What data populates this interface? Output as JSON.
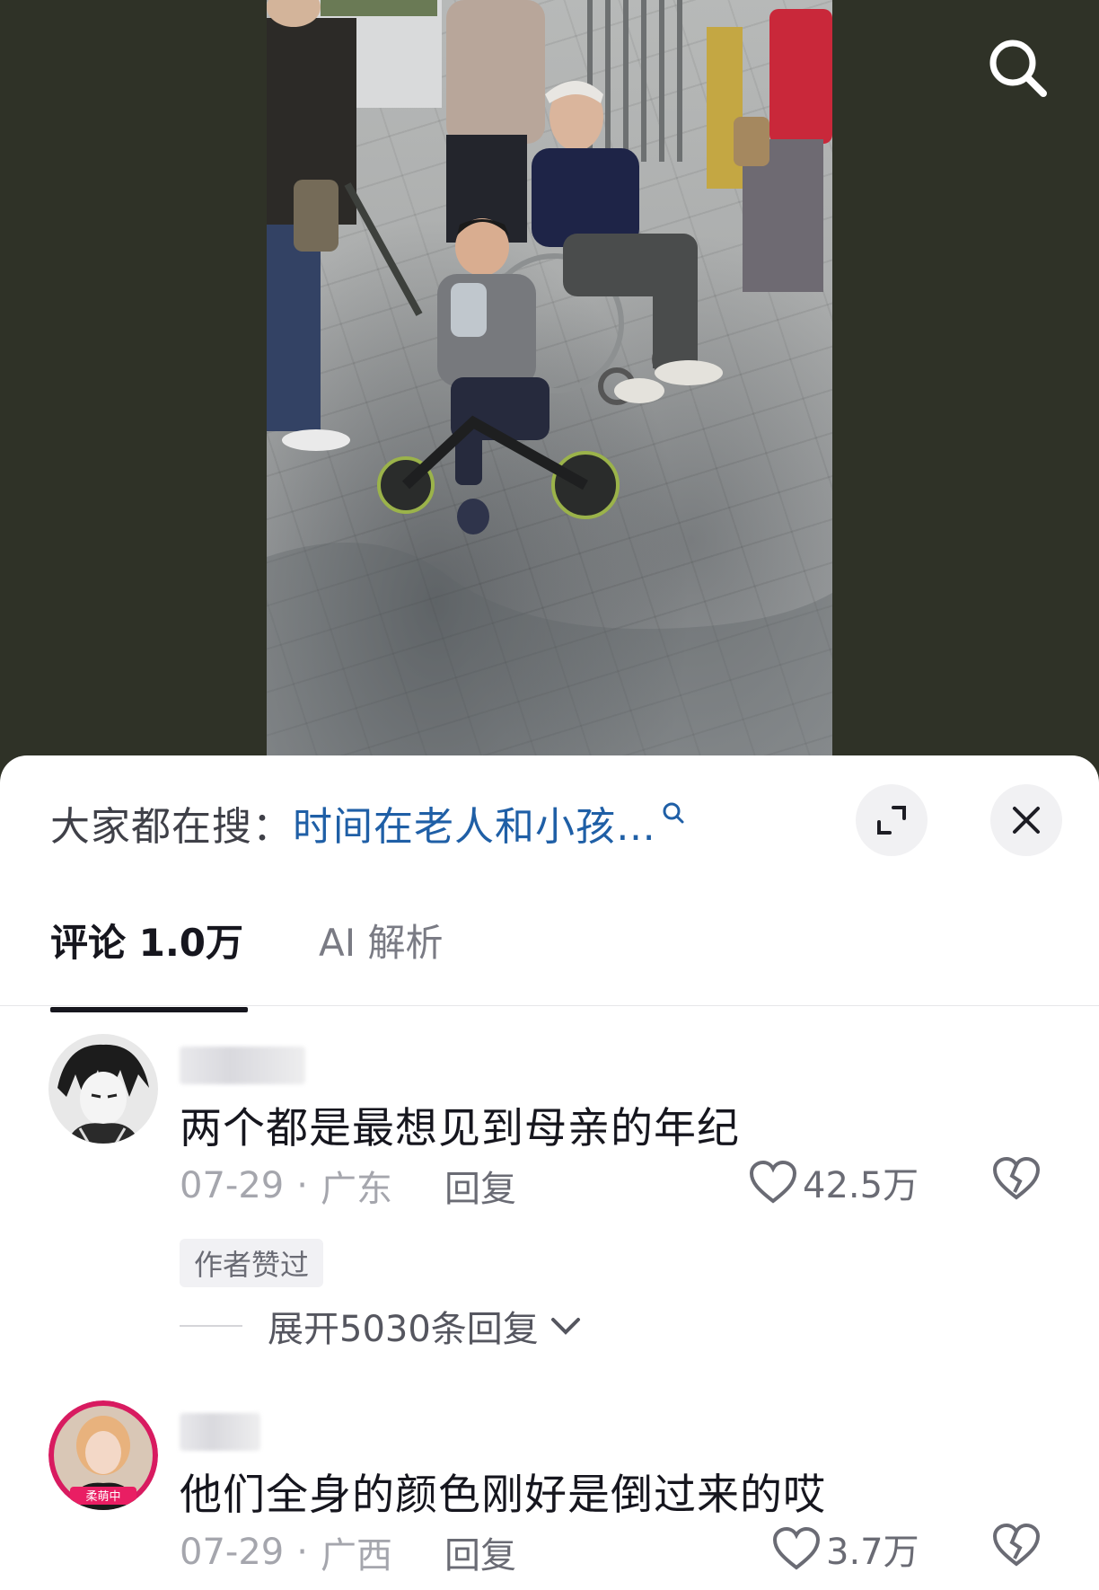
{
  "sheet": {
    "hot_search_label": "大家都在搜：",
    "hot_search_query": "时间在老人和小孩…"
  },
  "tabs": [
    {
      "label": "评论 1.0万"
    },
    {
      "label": "AI 解析"
    }
  ],
  "comments": [
    {
      "text": "两个都是最想见到母亲的年纪",
      "date": "07-29",
      "location": "广东",
      "reply_label": "回复",
      "likes": "42.5万",
      "author_liked": "作者赞过",
      "expand_replies": "展开5030条回复"
    },
    {
      "text": "他们全身的颜色刚好是倒过来的哎",
      "date": "07-29",
      "location": "广西",
      "reply_label": "回复",
      "likes": "3.7万",
      "avatar_badge": "柔萌中"
    }
  ],
  "colors": {
    "link_blue": "#1f5fa6",
    "video_background": "#2f3227",
    "text_primary": "#16161e",
    "text_secondary": "#a5a6ad"
  }
}
